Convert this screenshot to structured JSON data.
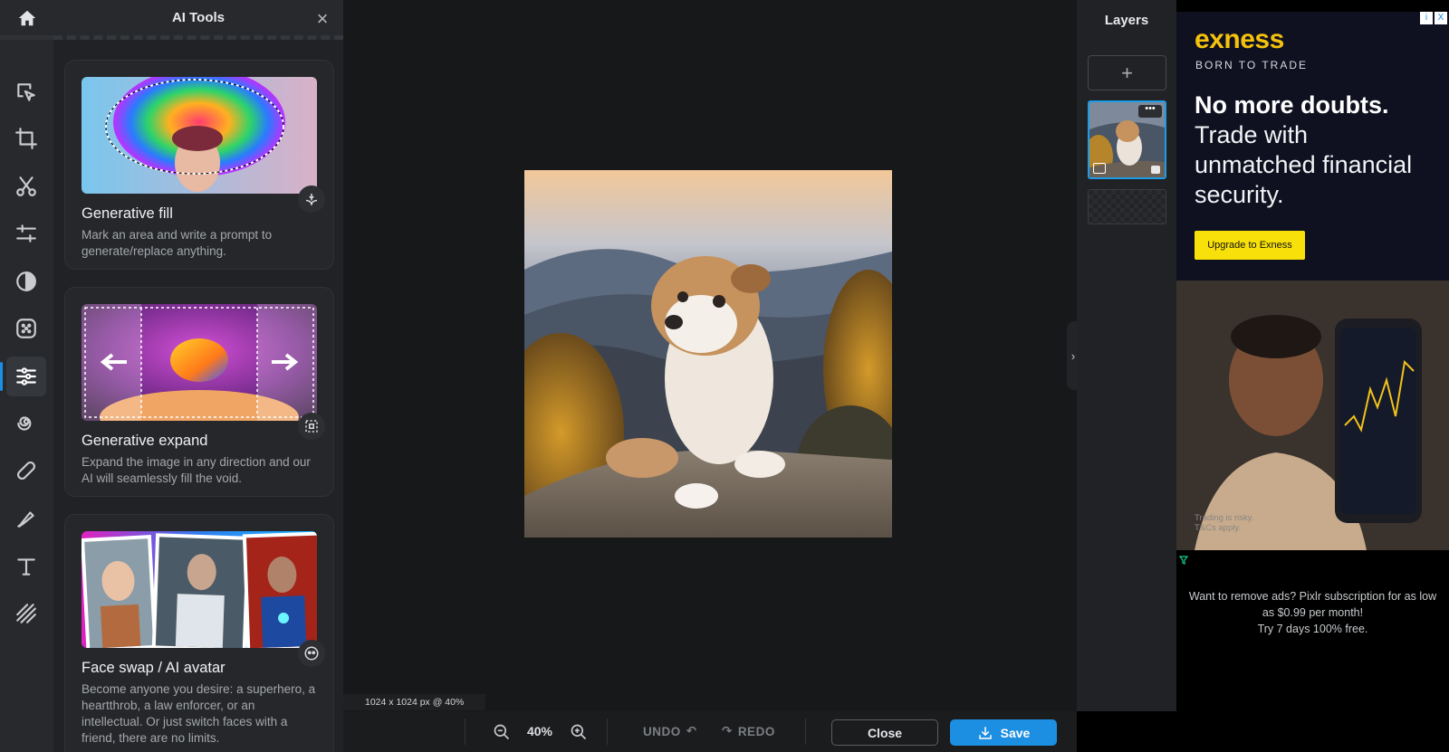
{
  "panel": {
    "title": "AI Tools",
    "close_glyph": "×",
    "cards": [
      {
        "title": "Generative fill",
        "desc": "Mark an area and write a prompt to generate/replace anything.",
        "badge_icon": "generative-fill-icon"
      },
      {
        "title": "Generative expand",
        "desc": "Expand the image in any direction and our AI will seamlessly fill the void.",
        "badge_icon": "expand-icon"
      },
      {
        "title": "Face swap / AI avatar",
        "desc": "Become anyone you desire: a superhero, a heartthrob, a law enforcer, or an intellectual. Or just switch faces with a friend, there are no limits.",
        "badge_icon": "face-icon"
      }
    ]
  },
  "rail": {
    "tools": [
      "home-icon",
      "arrange-icon",
      "crop-icon",
      "cut-icon",
      "adjust-icon",
      "filter-icon",
      "effect-icon",
      "ai-tools-icon",
      "liquify-icon",
      "retouch-icon",
      "draw-icon",
      "text-icon",
      "pattern-icon"
    ],
    "active_tool": "ai-tools-icon"
  },
  "canvas": {
    "dimensions": "1024 x 1024 px @ 40%",
    "collapse_glyph": "›"
  },
  "bottombar": {
    "zoom": "40%",
    "undo": "UNDO",
    "redo": "REDO",
    "close": "Close",
    "save": "Save"
  },
  "layers": {
    "title": "Layers",
    "add_glyph": "+",
    "menu_glyph": "•••"
  },
  "ad": {
    "brand": "exness",
    "tagline": "BORN TO TRADE",
    "headline": "No more doubts.",
    "body": "Trade with unmatched financial security.",
    "cta": "Upgrade to Exness",
    "risk": "Trading is risky. T&Cs apply.",
    "badge_info": "i",
    "badge_close": "X",
    "remove_ads_1": "Want to remove ads? Pixlr subscription for as low as $0.99 per month!",
    "remove_ads_2": "Try 7 days 100% free."
  },
  "colors": {
    "accent": "#1d8fe2",
    "ad_brand": "#f4c20d",
    "ad_cta": "#f8e10a"
  }
}
